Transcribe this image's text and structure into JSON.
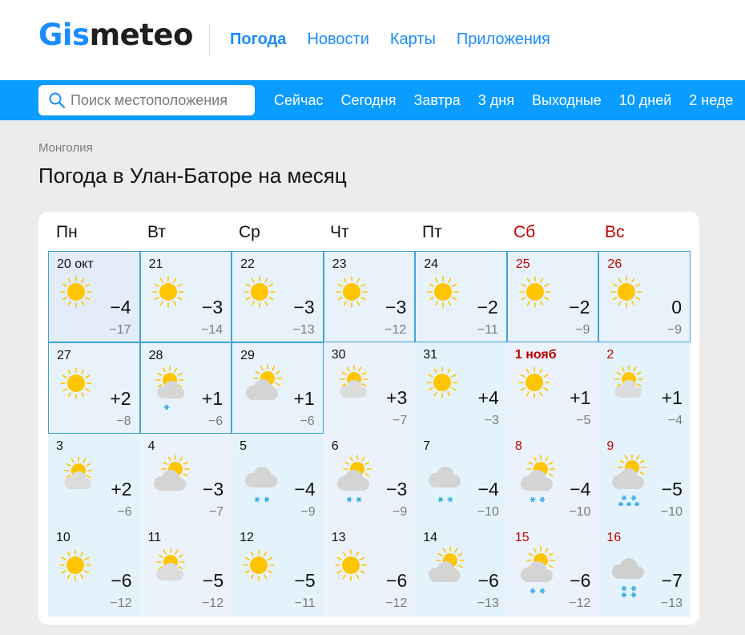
{
  "header": {
    "logo_part1": "Gis",
    "logo_part2": "meteo",
    "nav": [
      "Погода",
      "Новости",
      "Карты",
      "Приложения"
    ]
  },
  "search": {
    "placeholder": "Поиск местоположения"
  },
  "subnav": [
    "Сейчас",
    "Сегодня",
    "Завтра",
    "3 дня",
    "Выходные",
    "10 дней",
    "2 неде"
  ],
  "breadcrumb": "Монголия",
  "page_title": "Погода в Улан-Баторе на месяц",
  "colors": {
    "brand_blue": "#1a8cff",
    "bar_blue": "#0a9dff",
    "weekend_red": "#c00000",
    "past_border": "#3ea2db",
    "sun": "#ffc500",
    "cloud": "#d9d9d9",
    "precip": "#29a8e0"
  },
  "weekdays": [
    {
      "label": "Пн",
      "weekend": false
    },
    {
      "label": "Вт",
      "weekend": false
    },
    {
      "label": "Ср",
      "weekend": false
    },
    {
      "label": "Чт",
      "weekend": false
    },
    {
      "label": "Пт",
      "weekend": false
    },
    {
      "label": "Сб",
      "weekend": true
    },
    {
      "label": "Вс",
      "weekend": true
    }
  ],
  "days": [
    {
      "date": "20 окт",
      "hi": "−4",
      "lo": "−17",
      "icon": "sun-icon"
    },
    {
      "date": "21",
      "hi": "−3",
      "lo": "−14",
      "icon": "sun-icon"
    },
    {
      "date": "22",
      "hi": "−3",
      "lo": "−13",
      "icon": "sun-icon"
    },
    {
      "date": "23",
      "hi": "−3",
      "lo": "−12",
      "icon": "sun-icon"
    },
    {
      "date": "24",
      "hi": "−2",
      "lo": "−11",
      "icon": "sun-icon"
    },
    {
      "date": "25",
      "hi": "−2",
      "lo": "−9",
      "icon": "sun-icon"
    },
    {
      "date": "26",
      "hi": "0",
      "lo": "−9",
      "icon": "sun-icon"
    },
    {
      "date": "27",
      "hi": "+2",
      "lo": "−8",
      "icon": "sun-icon"
    },
    {
      "date": "28",
      "hi": "+1",
      "lo": "−6",
      "icon": "sun-cloud-snow-rain-icon"
    },
    {
      "date": "29",
      "hi": "+1",
      "lo": "−6",
      "icon": "sun-cloudy-icon"
    },
    {
      "date": "30",
      "hi": "+3",
      "lo": "−7",
      "icon": "sun-cloud-icon"
    },
    {
      "date": "31",
      "hi": "+4",
      "lo": "−3",
      "icon": "sun-icon"
    },
    {
      "date": "1 нояб",
      "hi": "+1",
      "lo": "−5",
      "icon": "sun-icon"
    },
    {
      "date": "2",
      "hi": "+1",
      "lo": "−4",
      "icon": "sun-cloud-icon"
    },
    {
      "date": "3",
      "hi": "+2",
      "lo": "−6",
      "icon": "sun-cloud-icon"
    },
    {
      "date": "4",
      "hi": "−3",
      "lo": "−7",
      "icon": "sun-cloudy-icon"
    },
    {
      "date": "5",
      "hi": "−4",
      "lo": "−9",
      "icon": "cloudy-light-snow-icon"
    },
    {
      "date": "6",
      "hi": "−3",
      "lo": "−9",
      "icon": "sun-cloud-light-snow-icon"
    },
    {
      "date": "7",
      "hi": "−4",
      "lo": "−10",
      "icon": "cloudy-light-snow-icon"
    },
    {
      "date": "8",
      "hi": "−4",
      "lo": "−10",
      "icon": "sun-cloud-light-snow-icon"
    },
    {
      "date": "9",
      "hi": "−5",
      "lo": "−10",
      "icon": "sun-cloud-snow-icon"
    },
    {
      "date": "10",
      "hi": "−6",
      "lo": "−12",
      "icon": "sun-icon"
    },
    {
      "date": "11",
      "hi": "−5",
      "lo": "−12",
      "icon": "sun-cloud-icon"
    },
    {
      "date": "12",
      "hi": "−5",
      "lo": "−11",
      "icon": "sun-icon"
    },
    {
      "date": "13",
      "hi": "−6",
      "lo": "−12",
      "icon": "sun-icon"
    },
    {
      "date": "14",
      "hi": "−6",
      "lo": "−13",
      "icon": "sun-cloudy-icon"
    },
    {
      "date": "15",
      "hi": "−6",
      "lo": "−12",
      "icon": "sun-cloud-light-snow-icon"
    },
    {
      "date": "16",
      "hi": "−7",
      "lo": "−13",
      "icon": "cloudy-snow-icon"
    }
  ]
}
